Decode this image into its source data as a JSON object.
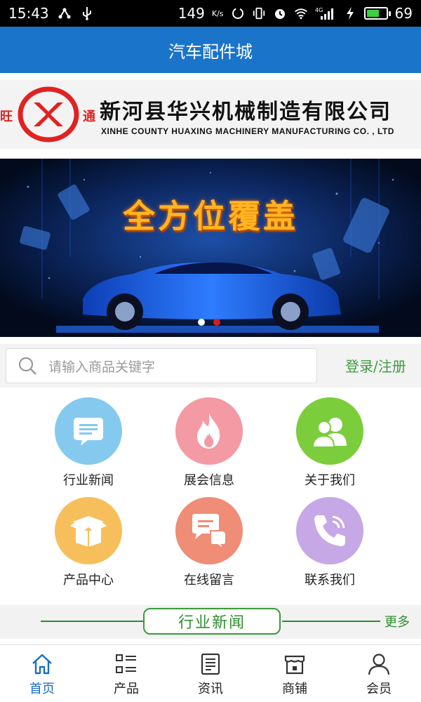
{
  "status_bar": {
    "time": "15:43",
    "network_speed": "149",
    "network_speed_unit": "K/s",
    "signal_type": "4G",
    "battery_level": "69",
    "battery_fraction": 0.69
  },
  "app_bar": {
    "title": "汽车配件城"
  },
  "company_banner": {
    "name_cn": "新河县华兴机械制造有限公司",
    "name_en": "XINHE COUNTY HUAXING MACHINERY MANUFACTURING CO. , LTD",
    "logo_left_char": "旺",
    "logo_right_char": "通"
  },
  "carousel": {
    "headline": "全方位覆盖",
    "slide_count": 2,
    "active_index": 1
  },
  "search": {
    "placeholder": "请输入商品关键字",
    "login_label": "登录/注册"
  },
  "menu": {
    "items": [
      {
        "label": "行业新闻",
        "icon": "news-icon",
        "color": "#86c9ee"
      },
      {
        "label": "展会信息",
        "icon": "flame-icon",
        "color": "#f39aa5"
      },
      {
        "label": "关于我们",
        "icon": "users-icon",
        "color": "#7ccd3c"
      },
      {
        "label": "产品中心",
        "icon": "box-icon",
        "color": "#f7bf5b"
      },
      {
        "label": "在线留言",
        "icon": "chat-icon",
        "color": "#ef8d76"
      },
      {
        "label": "联系我们",
        "icon": "phone-icon",
        "color": "#c6a8e6"
      }
    ]
  },
  "section": {
    "title": "行业新闻",
    "more_label": "更多"
  },
  "tab_bar": {
    "items": [
      {
        "label": "首页",
        "icon": "home-icon",
        "active": true
      },
      {
        "label": "产品",
        "icon": "list-icon",
        "active": false
      },
      {
        "label": "资讯",
        "icon": "article-icon",
        "active": false
      },
      {
        "label": "商铺",
        "icon": "shop-icon",
        "active": false
      },
      {
        "label": "会员",
        "icon": "user-icon",
        "active": false
      }
    ]
  },
  "colors": {
    "app_bar": "#1a74c9",
    "accent_green": "#3f9b3d",
    "active_tab": "#1a6fc0",
    "carousel_active_dot": "#d21e1e"
  }
}
